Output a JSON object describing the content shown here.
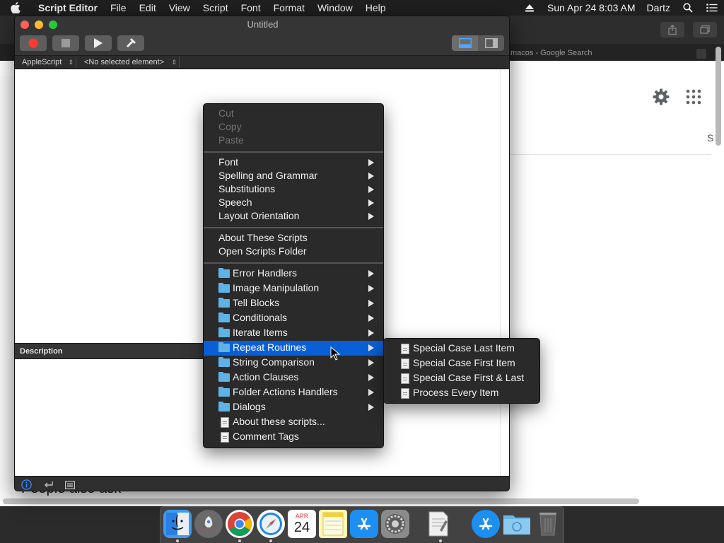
{
  "menubar": {
    "app_name": "Script Editor",
    "menus": [
      "File",
      "Edit",
      "View",
      "Script",
      "Font",
      "Format",
      "Window",
      "Help"
    ],
    "datetime": "Sun Apr 24  8:03 AM",
    "user": "Dartz"
  },
  "background_window": {
    "tab_title": "macos - Google Search",
    "partial_letter": "S",
    "partial_text": "People also ask"
  },
  "script_window": {
    "title": "Untitled",
    "language_popup": "AppleScript",
    "element_popup": "<No selected element>",
    "description_label": "Description"
  },
  "context_menu": {
    "edit_items": [
      "Cut",
      "Copy",
      "Paste"
    ],
    "format_items": [
      "Font",
      "Spelling and Grammar",
      "Substitutions",
      "Speech",
      "Layout Orientation"
    ],
    "script_links": [
      "About These Scripts",
      "Open Scripts Folder"
    ],
    "folders": [
      "Error Handlers",
      "Image Manipulation",
      "Tell Blocks",
      "Conditionals",
      "Iterate Items",
      "Repeat Routines",
      "String Comparison",
      "Action Clauses",
      "Folder Actions Handlers",
      "Dialogs"
    ],
    "documents": [
      "About these scripts...",
      "Comment Tags"
    ],
    "highlighted": "Repeat Routines"
  },
  "submenu": {
    "items": [
      "Special Case Last Item",
      "Special Case First Item",
      "Special Case First & Last",
      "Process Every Item"
    ]
  },
  "dock": {
    "calendar_month": "APR",
    "calendar_day": "24"
  },
  "colors": {
    "highlight": "#0a5fd6",
    "folder": "#5eb2e6",
    "close": "#ff5f57",
    "minimize": "#febc2e",
    "zoom": "#28c840"
  }
}
